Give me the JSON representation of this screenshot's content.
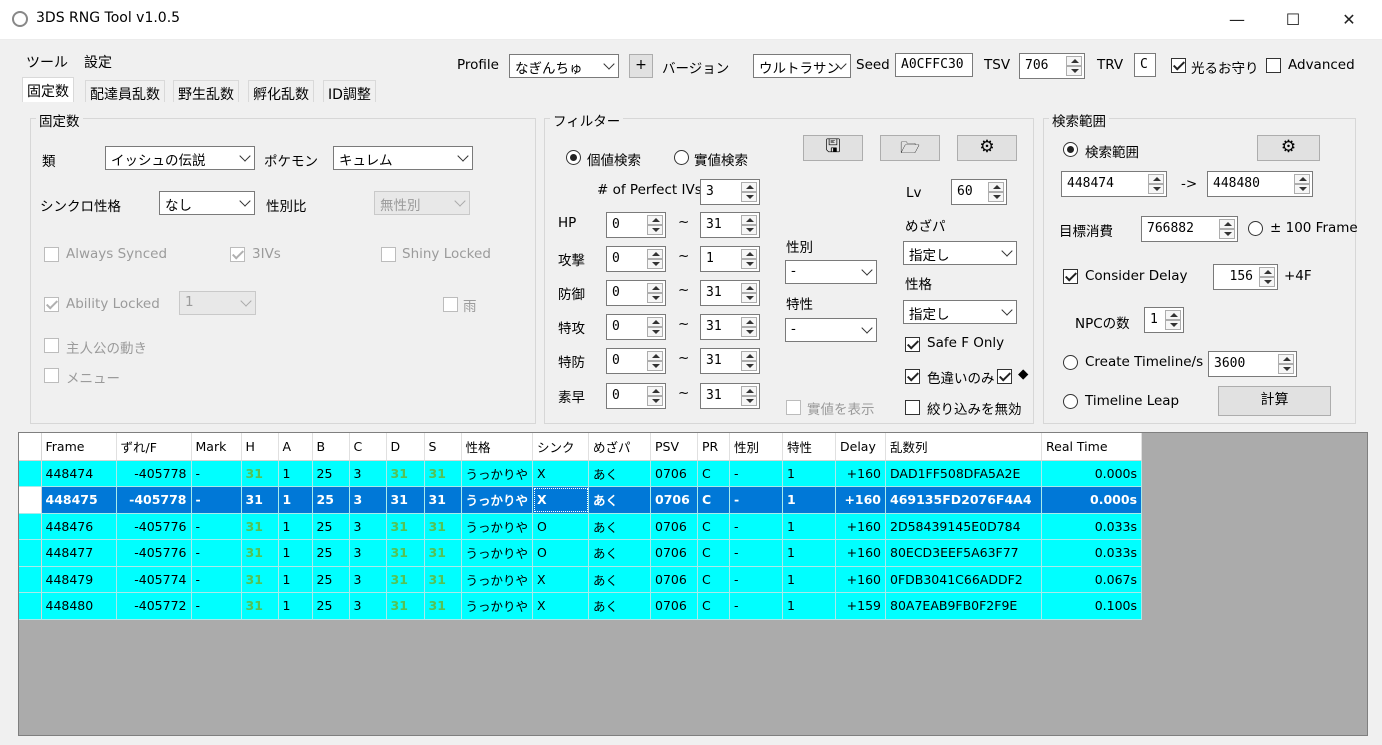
{
  "window": {
    "title": "3DS RNG Tool v1.0.5",
    "min": "—",
    "max": "☐",
    "close": "✕"
  },
  "menu": {
    "tools": "ツール",
    "settings": "設定"
  },
  "toolbar": {
    "profile_label": "Profile",
    "profile_value": "なぎんちゅ",
    "plus": "+",
    "version_label": "バージョン",
    "version_value": "ウルトラサン",
    "seed_label": "Seed",
    "seed_value": "A0CFFC30",
    "tsv_label": "TSV",
    "tsv_value": "706",
    "trv_label": "TRV",
    "trv_value": "C",
    "shiny_charm_label": "光るお守り",
    "advanced_label": "Advanced"
  },
  "tabs": [
    "固定数",
    "配達員乱数",
    "野生乱数",
    "孵化乱数",
    "ID調整"
  ],
  "stationary": {
    "group_title": "固定数",
    "category_label": "類",
    "category_value": "イッシュの伝説",
    "pokemon_label": "ポケモン",
    "pokemon_value": "キュレム",
    "sync_label": "シンクロ性格",
    "sync_value": "なし",
    "gender_ratio_label": "性別比",
    "gender_ratio_value": "無性別",
    "always_synced": "Always Synced",
    "three_ivs": "3IVs",
    "shiny_locked": "Shiny Locked",
    "ability_locked": "Ability Locked",
    "ability_value": "1",
    "rain": "雨",
    "player_move": "主人公の動き",
    "menu": "メニュー"
  },
  "filter": {
    "group_title": "フィルター",
    "iv_search": "個値検索",
    "stat_search": "實値検索",
    "perfect_ivs_label": "# of Perfect IVs",
    "perfect_ivs_value": "3",
    "tilde": "~",
    "stats": [
      {
        "label": "HP",
        "min": "0",
        "max": "31"
      },
      {
        "label": "攻撃",
        "min": "0",
        "max": "1"
      },
      {
        "label": "防御",
        "min": "0",
        "max": "31"
      },
      {
        "label": "特攻",
        "min": "0",
        "max": "31"
      },
      {
        "label": "特防",
        "min": "0",
        "max": "31"
      },
      {
        "label": "素早",
        "min": "0",
        "max": "31"
      }
    ],
    "gender_label": "性別",
    "gender_value": "-",
    "ability_label": "特性",
    "ability_value": "-",
    "lv_label": "Lv",
    "lv_value": "60",
    "hp_type_label": "めざパ",
    "hp_type_value": "指定し",
    "nature_label": "性格",
    "nature_value": "指定し",
    "safe_f_only": "Safe F Only",
    "shiny_only": "色違いのみ",
    "diamond": "◆",
    "show_stats": "實値を表示",
    "disable_filter": "絞り込みを無効"
  },
  "search": {
    "group_title": "検索範囲",
    "range_label": "検索範囲",
    "from": "448474",
    "arrow": "->",
    "to": "448480",
    "target_label": "目標消費",
    "target_value": "766882",
    "pm100": "± 100 Frame",
    "consider_delay": "Consider Delay",
    "delay_value": "156",
    "plus4f": "+4F",
    "npc_label": "NPCの数",
    "npc_value": "1",
    "create_timeline": "Create Timeline/s",
    "timeline_value": "3600",
    "timeline_leap": "Timeline Leap",
    "calc": "計算"
  },
  "table": {
    "headers": [
      "Frame",
      "ずれ/F",
      "Mark",
      "H",
      "A",
      "B",
      "C",
      "D",
      "S",
      "性格",
      "シンク",
      "めざパ",
      "PSV",
      "PR",
      "性別",
      "特性",
      "Delay",
      "乱数列",
      "Real Time"
    ],
    "rows": [
      [
        "448474",
        "-405778",
        "-",
        "31",
        "1",
        "25",
        "3",
        "31",
        "31",
        "うっかりや",
        "X",
        "あく",
        "0706",
        "C",
        "-",
        "1",
        "+160",
        "DAD1FF508DFA5A2E",
        "0.000s"
      ],
      [
        "448475",
        "-405778",
        "-",
        "31",
        "1",
        "25",
        "3",
        "31",
        "31",
        "うっかりや",
        "X",
        "あく",
        "0706",
        "C",
        "-",
        "1",
        "+160",
        "469135FD2076F4A4",
        "0.000s"
      ],
      [
        "448476",
        "-405776",
        "-",
        "31",
        "1",
        "25",
        "3",
        "31",
        "31",
        "うっかりや",
        "O",
        "あく",
        "0706",
        "C",
        "-",
        "1",
        "+160",
        "2D58439145E0D784",
        "0.033s"
      ],
      [
        "448477",
        "-405776",
        "-",
        "31",
        "1",
        "25",
        "3",
        "31",
        "31",
        "うっかりや",
        "O",
        "あく",
        "0706",
        "C",
        "-",
        "1",
        "+160",
        "80ECD3EEF5A63F77",
        "0.033s"
      ],
      [
        "448479",
        "-405774",
        "-",
        "31",
        "1",
        "25",
        "3",
        "31",
        "31",
        "うっかりや",
        "X",
        "あく",
        "0706",
        "C",
        "-",
        "1",
        "+160",
        "0FDB3041C66ADDF2",
        "0.067s"
      ],
      [
        "448480",
        "-405772",
        "-",
        "31",
        "1",
        "25",
        "3",
        "31",
        "31",
        "うっかりや",
        "X",
        "あく",
        "0706",
        "C",
        "-",
        "1",
        "+159",
        "80A7EAB9FB0F2F9E",
        "0.100s"
      ]
    ],
    "selected_index": 1
  },
  "colors": {
    "row_bg": "#00ffff",
    "selected_bg": "#0078d7",
    "perfect_iv": "#55c255"
  }
}
